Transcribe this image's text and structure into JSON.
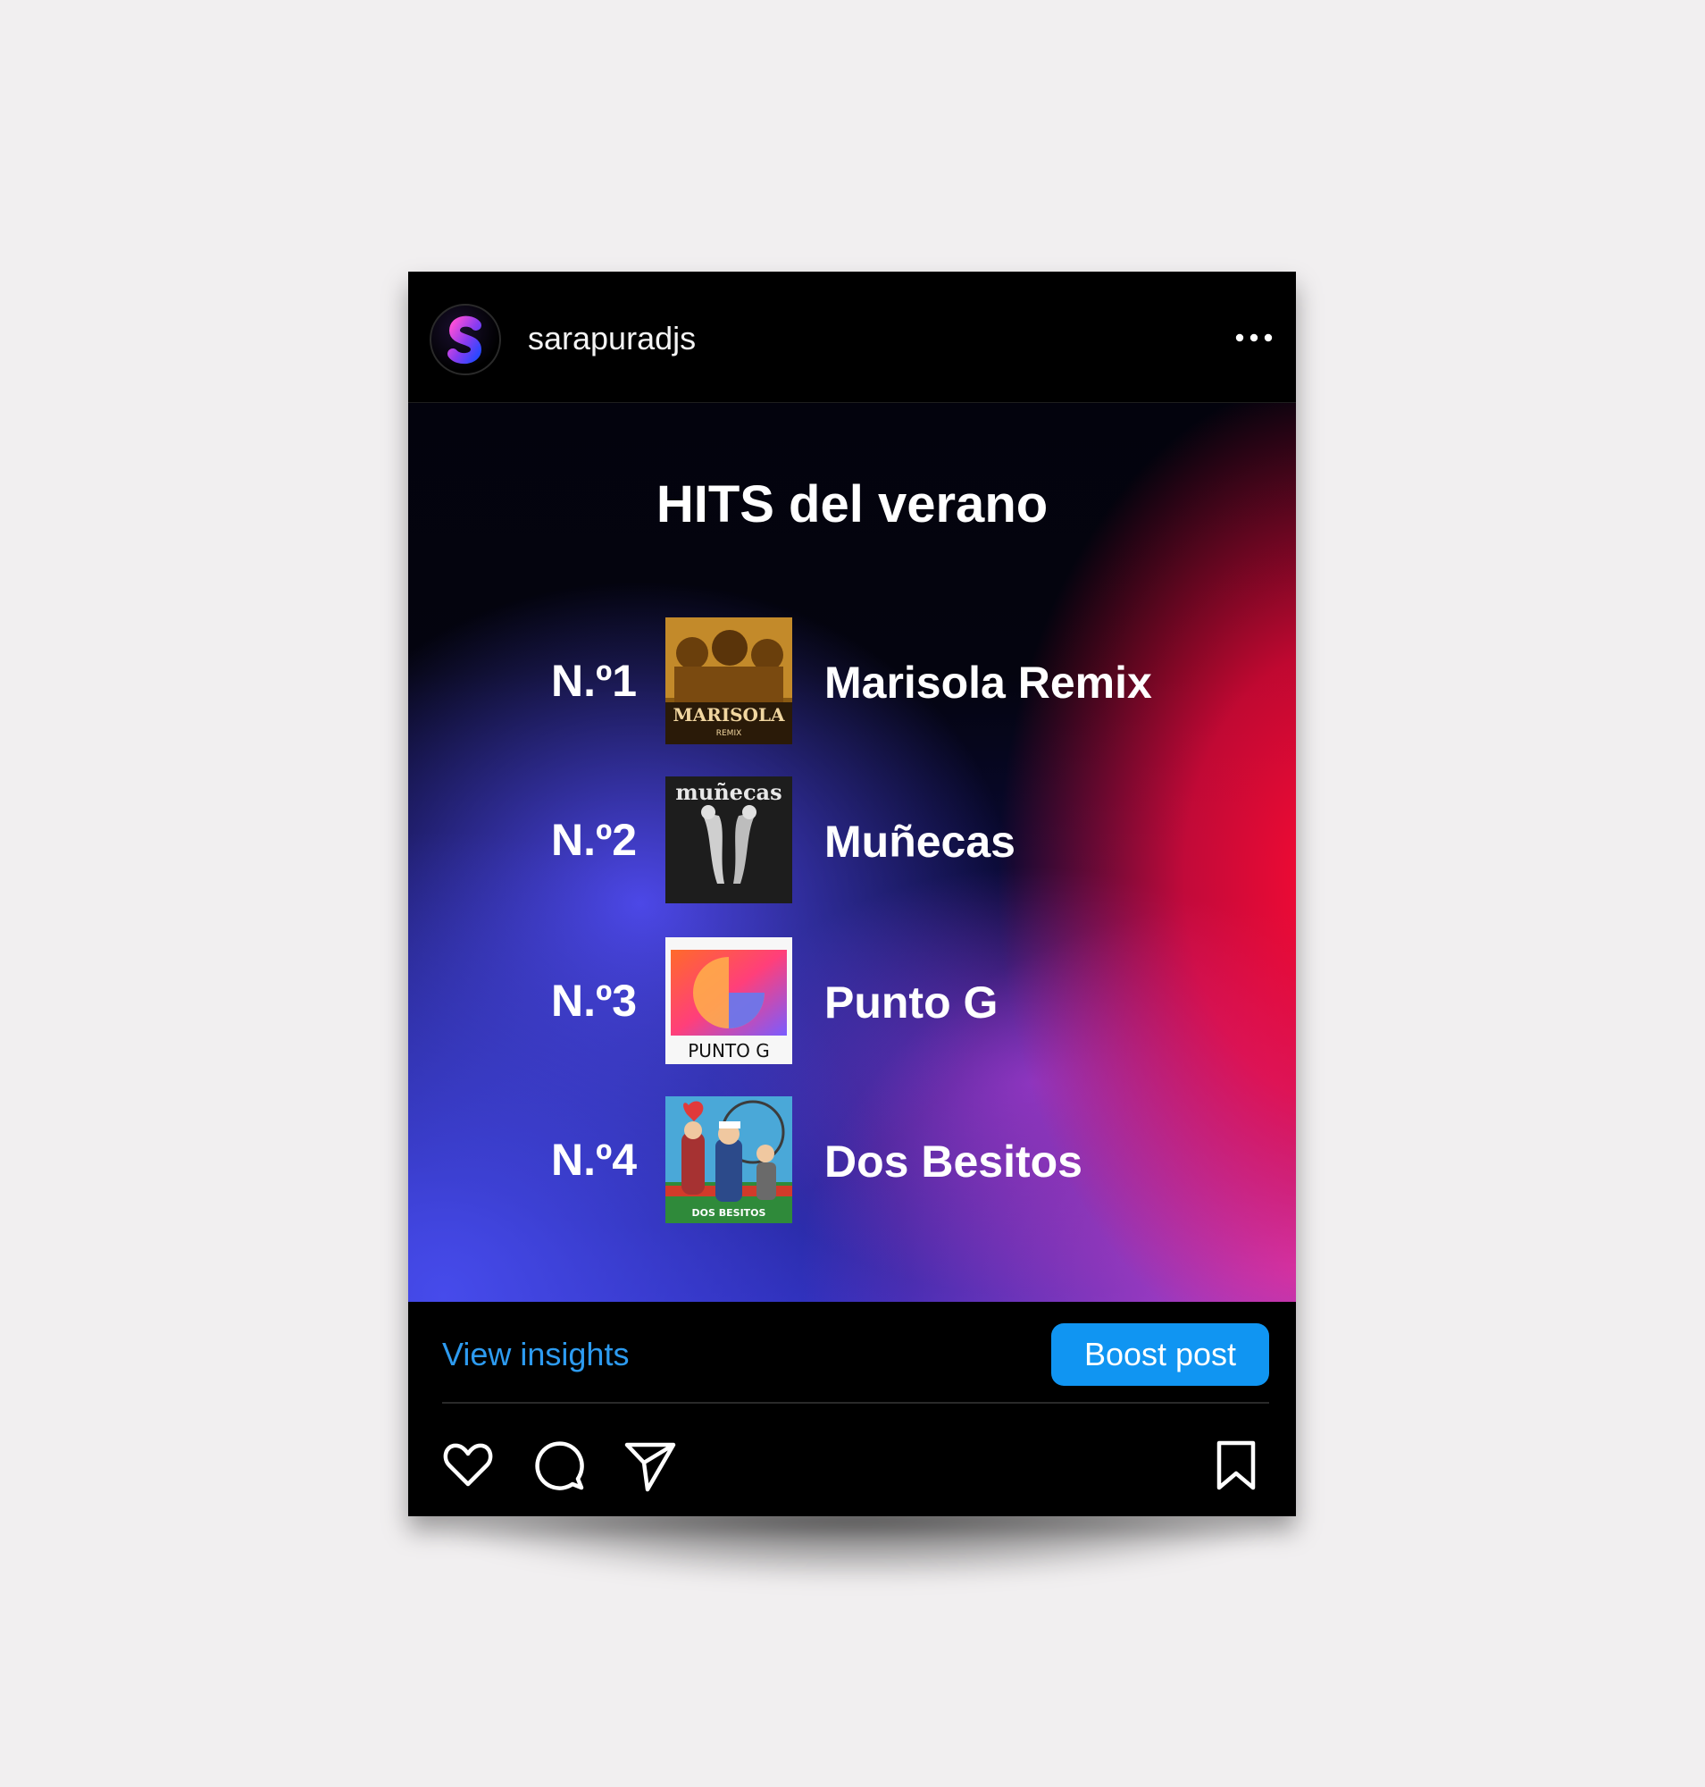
{
  "post": {
    "username": "sarapuradjs",
    "menu_icon": "more-horizontal-icon"
  },
  "image": {
    "title": "HITS del verano",
    "tracks": [
      {
        "rank": "N.º1",
        "song": "Marisola Remix",
        "cover_text": "MARISOLA",
        "cover_subtext": "REMIX"
      },
      {
        "rank": "N.º2",
        "song": "Muñecas",
        "cover_text": "muñecas"
      },
      {
        "rank": "N.º3",
        "song": "Punto G",
        "cover_text": "PUNTO G"
      },
      {
        "rank": "N.º4",
        "song": "Dos Besitos",
        "cover_text": "DOS BESITOS"
      }
    ]
  },
  "footer": {
    "insights_label": "View insights",
    "boost_label": "Boost post"
  },
  "actions": [
    "heart-icon",
    "comment-icon",
    "share-icon",
    "bookmark-icon"
  ],
  "colors": {
    "accent_blue": "#1095f2",
    "link_blue": "#2d9bf0",
    "background": "#f1eff0"
  }
}
